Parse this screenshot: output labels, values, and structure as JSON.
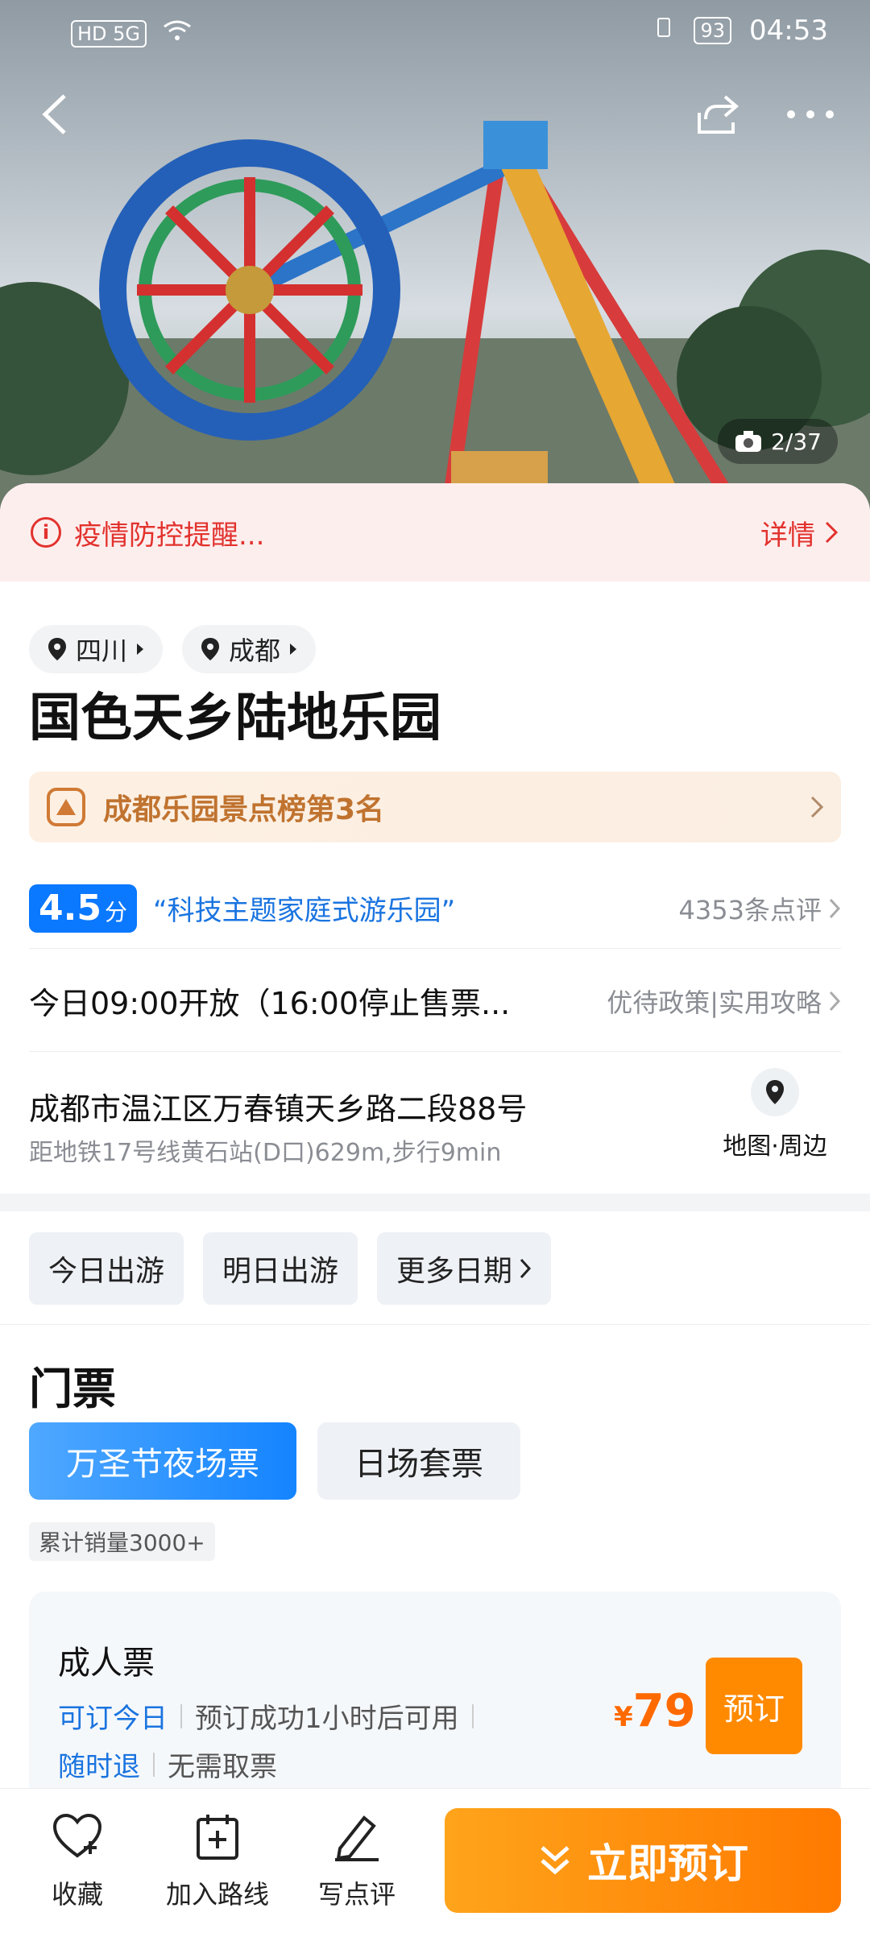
{
  "status_bar": {
    "left": "HD 5G",
    "battery": "93",
    "time": "04:53"
  },
  "hero": {
    "photo_count": "2/37"
  },
  "notice": {
    "text": "疫情防控提醒...",
    "detail": "详情"
  },
  "location": {
    "province": "四川",
    "city": "成都"
  },
  "attraction": {
    "title": "国色天乡陆地乐园"
  },
  "ranking": {
    "text": "成都乐园景点榜第3名"
  },
  "rating": {
    "score": "4.5",
    "unit": "分",
    "quote": "“科技主题家庭式游乐园”",
    "reviews": "4353条点评"
  },
  "hours": {
    "text": "今日09:00开放（16:00停止售票...",
    "links": "优待政策|实用攻略"
  },
  "address": {
    "main": "成都市温江区万春镇天乡路二段88号",
    "sub": "距地铁17号线黄石站(D口)629m,步行9min",
    "map_label": "地图·周边"
  },
  "dates": {
    "today": "今日出游",
    "tomorrow": "明日出游",
    "more": "更多日期"
  },
  "tickets": {
    "section_title": "门票",
    "tab_active": "万圣节夜场票",
    "tab_other": "日场套票",
    "sales": "累计销量3000+",
    "item": {
      "name": "成人票",
      "tag1": "可订今日",
      "tag1_note": "预订成功1小时后可用",
      "tag2": "随时退",
      "tag2_note": "无需取票",
      "currency": "¥",
      "price": "79",
      "book": "预订"
    }
  },
  "bottom_bar": {
    "favorite": "收藏",
    "add_route": "加入路线",
    "review": "写点评",
    "book_now": "立即预订"
  },
  "colors": {
    "accent_blue": "#1484ff",
    "accent_orange": "#ff7a00",
    "alert_red": "#e2322d"
  }
}
